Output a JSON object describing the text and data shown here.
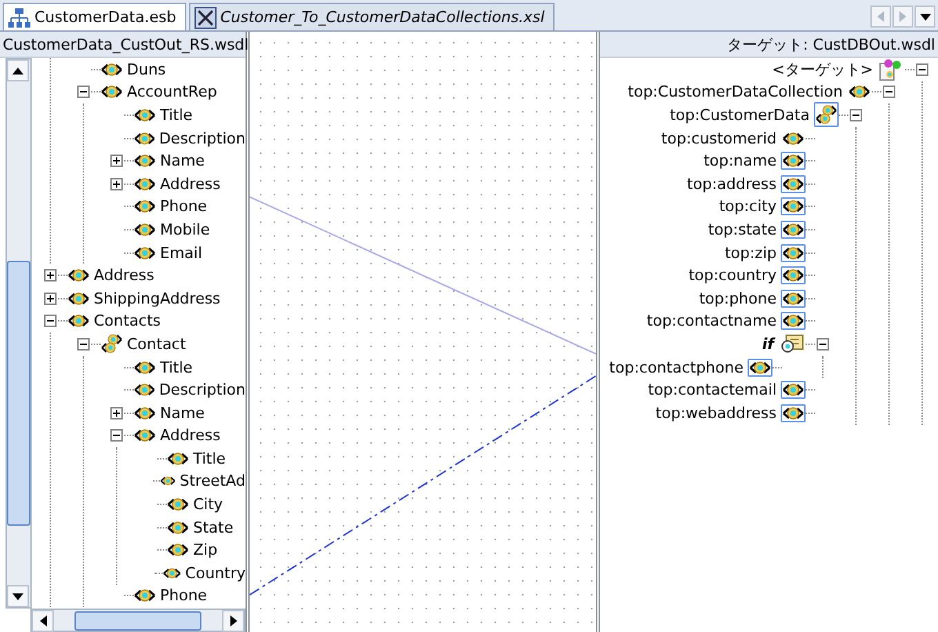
{
  "tabs": [
    {
      "label": "CustomerData.esb",
      "kind": "diagram",
      "selected": true
    },
    {
      "label": "Customer_To_CustomerDataCollections.xsl",
      "kind": "map",
      "selected": false
    }
  ],
  "source": {
    "title": "CustomerData_CustOut_RS.wsdl",
    "clipped_parent_children": [
      {
        "label": "Duns",
        "kind": "element"
      },
      {
        "label": "AccountRep",
        "kind": "element",
        "expanded": true,
        "children": [
          {
            "label": "Title",
            "kind": "element"
          },
          {
            "label": "Description",
            "kind": "element"
          },
          {
            "label": "Name",
            "kind": "element",
            "expanded": false
          },
          {
            "label": "Address",
            "kind": "element",
            "expanded": false
          },
          {
            "label": "Phone",
            "kind": "element"
          },
          {
            "label": "Mobile",
            "kind": "element"
          },
          {
            "label": "Email",
            "kind": "element"
          }
        ]
      }
    ],
    "items": [
      {
        "label": "Address",
        "kind": "element",
        "expanded": false
      },
      {
        "label": "ShippingAddress",
        "kind": "element",
        "expanded": false
      },
      {
        "label": "Contacts",
        "kind": "element",
        "expanded": true,
        "children": [
          {
            "label": "Contact",
            "kind": "collection",
            "expanded": true,
            "children": [
              {
                "label": "Title",
                "kind": "element"
              },
              {
                "label": "Description",
                "kind": "element"
              },
              {
                "label": "Name",
                "kind": "element",
                "expanded": false
              },
              {
                "label": "Address",
                "kind": "element",
                "expanded": true,
                "children": [
                  {
                    "label": "Title",
                    "kind": "element"
                  },
                  {
                    "label": "StreetAd",
                    "kind": "element"
                  },
                  {
                    "label": "City",
                    "kind": "element"
                  },
                  {
                    "label": "State",
                    "kind": "element"
                  },
                  {
                    "label": "Zip",
                    "kind": "element"
                  },
                  {
                    "label": "Country",
                    "kind": "element"
                  }
                ]
              },
              {
                "label": "Phone",
                "kind": "element"
              }
            ]
          }
        ]
      }
    ]
  },
  "target": {
    "title": "ターゲット: CustDBOut.wsdl",
    "items": [
      {
        "label": "<ターゲット>",
        "kind": "root",
        "expanded": true,
        "children": [
          {
            "label": "top:CustomerDataCollection",
            "kind": "element",
            "mapped": false,
            "expanded": true,
            "children": [
              {
                "label": "top:CustomerData",
                "kind": "collection",
                "mapped": true,
                "expanded": true,
                "children": [
                  {
                    "label": "top:customerid",
                    "kind": "element",
                    "mapped": false
                  },
                  {
                    "label": "top:name",
                    "kind": "element",
                    "mapped": true
                  },
                  {
                    "label": "top:address",
                    "kind": "element",
                    "mapped": true
                  },
                  {
                    "label": "top:city",
                    "kind": "element",
                    "mapped": true
                  },
                  {
                    "label": "top:state",
                    "kind": "element",
                    "mapped": true
                  },
                  {
                    "label": "top:zip",
                    "kind": "element",
                    "mapped": true
                  },
                  {
                    "label": "top:country",
                    "kind": "element",
                    "mapped": true
                  },
                  {
                    "label": "top:phone",
                    "kind": "element",
                    "mapped": true
                  },
                  {
                    "label": "top:contactname",
                    "kind": "element",
                    "mapped": true
                  },
                  {
                    "label": "if",
                    "kind": "if",
                    "expanded": true,
                    "children": [
                      {
                        "label": "top:contactphone",
                        "kind": "element",
                        "mapped": true
                      }
                    ]
                  },
                  {
                    "label": "top:contactemail",
                    "kind": "element",
                    "mapped": true
                  },
                  {
                    "label": "top:webaddress",
                    "kind": "element",
                    "mapped": true
                  }
                ]
              }
            ]
          }
        ]
      }
    ]
  }
}
